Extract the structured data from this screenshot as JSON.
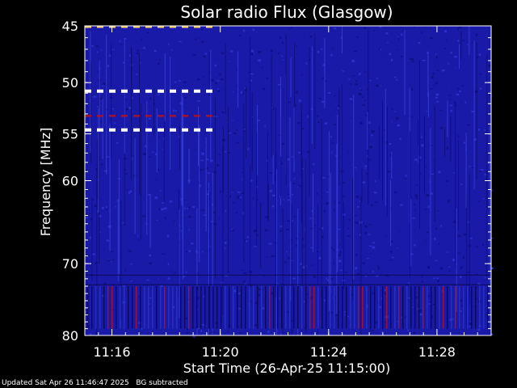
{
  "chart_data": {
    "type": "heatmap",
    "title": "Solar radio Flux (Glasgow)",
    "xlabel": "Start Time (26-Apr-25 11:15:00)",
    "ylabel": "Frequency [MHz]",
    "x_range_minutes": [
      0,
      15
    ],
    "x_start_time": "11:15:00",
    "x_ticks": [
      {
        "minute": 1,
        "label": "11:16"
      },
      {
        "minute": 5,
        "label": "11:20"
      },
      {
        "minute": 9,
        "label": "11:24"
      },
      {
        "minute": 13,
        "label": "11:28"
      }
    ],
    "y_range_mhz": [
      45,
      80
    ],
    "y_ticks": [
      {
        "mhz": 45,
        "label": "45"
      },
      {
        "mhz": 50,
        "label": "50"
      },
      {
        "mhz": 55,
        "label": "55"
      },
      {
        "mhz": 60,
        "label": "60"
      },
      {
        "mhz": 70,
        "label": "70"
      },
      {
        "mhz": 80,
        "label": "80"
      }
    ],
    "background_color": "#1a1aa8",
    "interference_bands_mhz": [
      {
        "mhz": 50.8,
        "from_minute": 0,
        "to_minute": 4.75,
        "color": "#ffffff"
      },
      {
        "mhz": 53.2,
        "from_minute": 0,
        "to_minute": 4.75,
        "color": "#c01010"
      },
      {
        "mhz": 54.6,
        "from_minute": 0,
        "to_minute": 4.75,
        "color": "#ffffff"
      },
      {
        "mhz": 45.1,
        "from_minute": 0,
        "to_minute": 4.75,
        "color": "#ffcc66"
      }
    ]
  },
  "footer": {
    "updated": "Updated Sat Apr 26 11:46:47 2025",
    "note": "BG subtracted"
  }
}
